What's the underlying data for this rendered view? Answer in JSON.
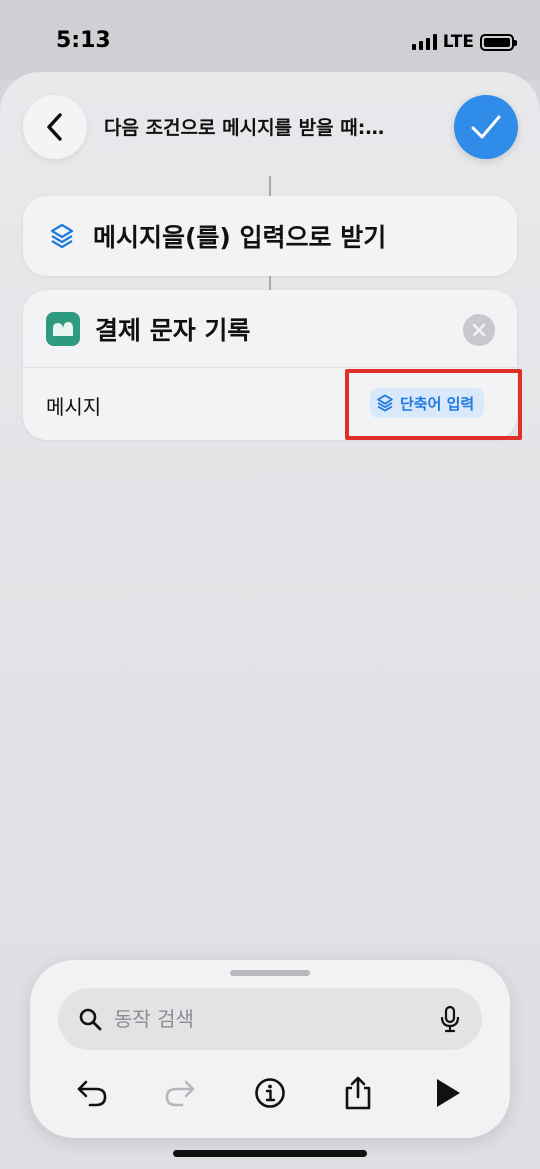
{
  "status_bar": {
    "time": "5:13",
    "network": "LTE"
  },
  "header": {
    "title": "다음 조건으로 메시지를 받을 때:…",
    "back_icon": "chevron-left-icon",
    "done_icon": "checkmark-icon"
  },
  "trigger": {
    "label": "메시지을(를) 입력으로 받기",
    "icon": "shortcut-input-icon"
  },
  "action": {
    "title": "결제 문자 기록",
    "app_icon": "app-icon",
    "remove_icon": "close-icon",
    "parameter_label": "메시지",
    "token_label": "단축어 입력",
    "token_icon": "shortcut-input-icon"
  },
  "bottom_panel": {
    "search_placeholder": "동작 검색",
    "search_value": "",
    "toolbar": [
      "undo",
      "redo",
      "info",
      "share",
      "run"
    ]
  },
  "colors": {
    "accent": "#2f8ce8",
    "token_background": "#d9e8fa",
    "token_text": "#1f7ae0",
    "app_icon": "#2c9b7f",
    "highlight": "#e0302a"
  }
}
